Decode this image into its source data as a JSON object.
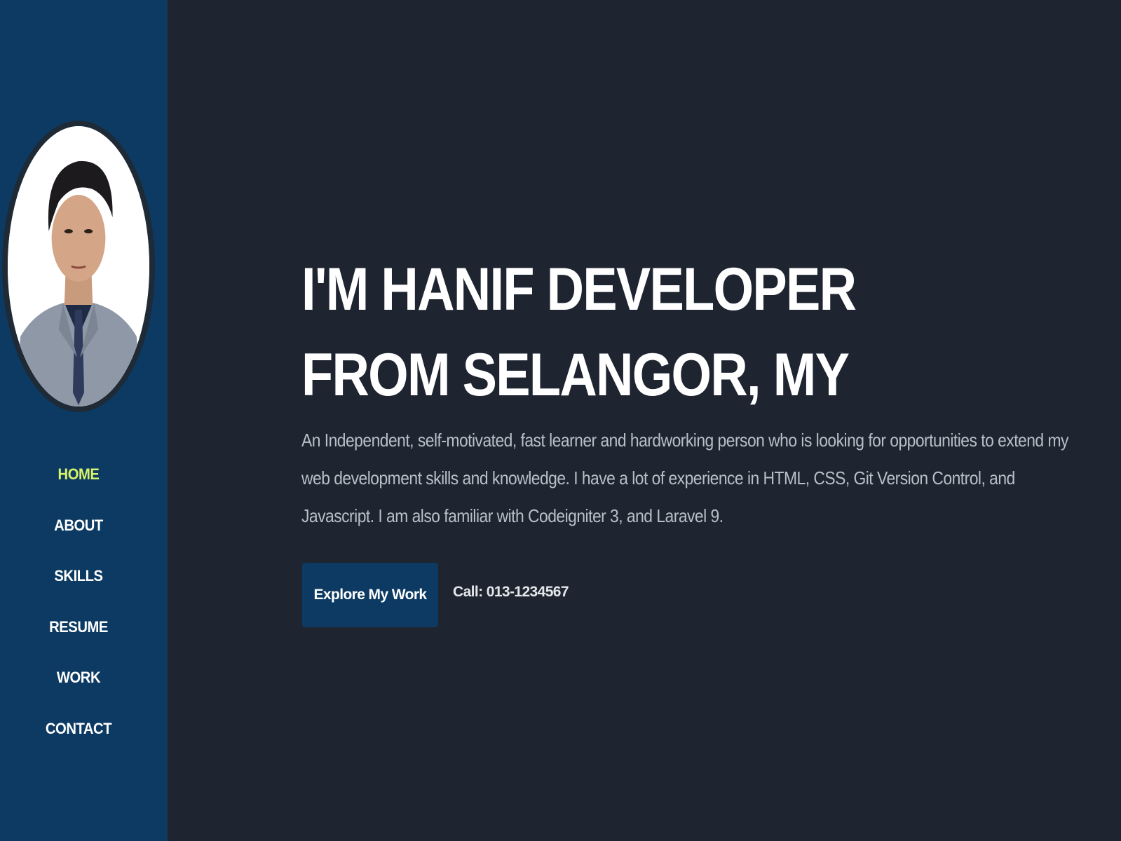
{
  "nav": {
    "items": [
      {
        "label": "HOME",
        "active": true
      },
      {
        "label": "ABOUT",
        "active": false
      },
      {
        "label": "SKILLS",
        "active": false
      },
      {
        "label": "RESUME",
        "active": false
      },
      {
        "label": "WORK",
        "active": false
      },
      {
        "label": "CONTACT",
        "active": false
      }
    ]
  },
  "hero": {
    "title": "I'M HANIF DEVELOPER FROM SELANGOR, MY",
    "description": "An Independent, self-motivated, fast learner and hardworking person who is looking for opportunities to extend my web development skills and knowledge. I have a lot of experience in HTML, CSS, Git Version Control, and Javascript. I am also familiar with Codeigniter 3, and Laravel 9.",
    "cta_label": "Explore My Work",
    "phone": "Call: 013-1234567"
  },
  "colors": {
    "sidebar_bg": "#0c3a62",
    "page_bg": "#1e2530",
    "active_nav": "#d9f36b",
    "button_bg": "#0c3a62",
    "text_primary": "#ffffff",
    "text_muted": "#b9bfc7"
  }
}
